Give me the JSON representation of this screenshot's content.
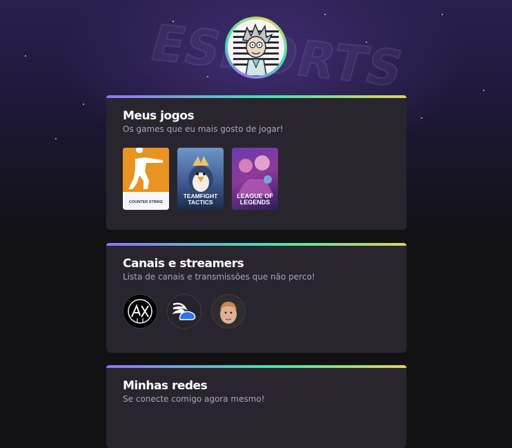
{
  "colors": {
    "accent_gradient": [
      "#9572fc",
      "#43e7ad",
      "#e2d45c"
    ],
    "card_bg": "#29252f",
    "page_bg": "#121214"
  },
  "background": {
    "watermark_text": "ESPORTS"
  },
  "profile": {
    "avatar_icon": "rick-avatar"
  },
  "games_section": {
    "title": "Meus jogos",
    "subtitle": "Os games que eu mais gosto de jogar!",
    "games": [
      {
        "name": "COUNTER STRIKE",
        "icon": "counter-strike-cover"
      },
      {
        "name": "TEAMFIGHT TACTICS",
        "icon": "teamfight-tactics-cover"
      },
      {
        "name": "LEAGUE OF LEGENDS",
        "icon": "league-of-legends-cover"
      }
    ]
  },
  "channels_section": {
    "title": "Canais e streamers",
    "subtitle": "Lista de canais e transmissões que não perco!",
    "channels": [
      {
        "icon": "channel-logo-ax"
      },
      {
        "icon": "channel-logo-winged-shoe"
      },
      {
        "icon": "streamer-photo"
      }
    ]
  },
  "social_section": {
    "title": "Minhas redes",
    "subtitle": "Se conecte comigo agora mesmo!"
  }
}
